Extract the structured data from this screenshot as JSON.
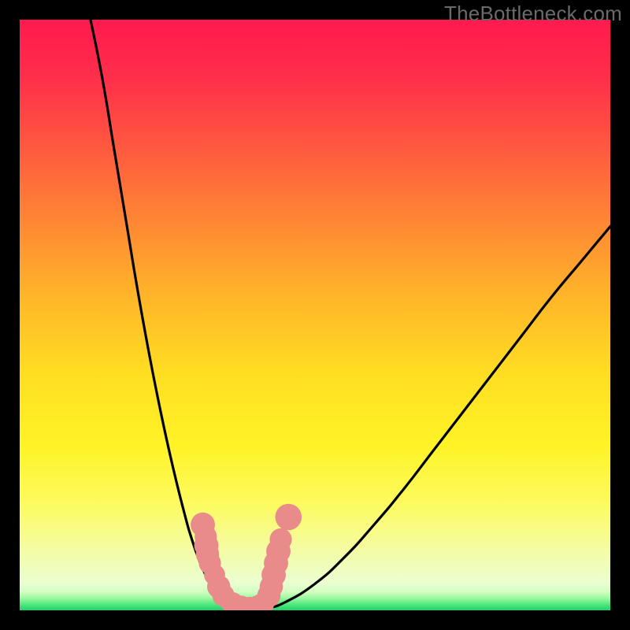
{
  "watermark": "TheBottleneck.com",
  "colors": {
    "background_black": "#000000",
    "curve_stroke": "#000000",
    "marker_fill": "#e98b8b",
    "marker_stroke": "#c56e6e"
  },
  "gradient_stops": [
    {
      "offset": 0.0,
      "color": "#ff1a4e"
    },
    {
      "offset": 0.1,
      "color": "#ff2f4a"
    },
    {
      "offset": 0.22,
      "color": "#ff5a3f"
    },
    {
      "offset": 0.35,
      "color": "#ff8a33"
    },
    {
      "offset": 0.48,
      "color": "#ffb928"
    },
    {
      "offset": 0.6,
      "color": "#ffde22"
    },
    {
      "offset": 0.72,
      "color": "#fff326"
    },
    {
      "offset": 0.82,
      "color": "#fdfb60"
    },
    {
      "offset": 0.9,
      "color": "#f4fca6"
    },
    {
      "offset": 0.955,
      "color": "#eafed2"
    },
    {
      "offset": 0.975,
      "color": "#c6ffb8"
    },
    {
      "offset": 0.988,
      "color": "#72f88f"
    },
    {
      "offset": 1.0,
      "color": "#22e06a"
    }
  ],
  "green_strip": {
    "top_frac": 0.968,
    "stops": [
      {
        "offset": 0.0,
        "color": "#d8ffc6"
      },
      {
        "offset": 0.35,
        "color": "#9cf9a0"
      },
      {
        "offset": 0.7,
        "color": "#4fe77e"
      },
      {
        "offset": 1.0,
        "color": "#1dd268"
      }
    ]
  },
  "chart_data": {
    "type": "line",
    "title": "",
    "xlabel": "",
    "ylabel": "",
    "xlim": [
      0,
      100
    ],
    "ylim": [
      0,
      100
    ],
    "annotations": [
      "TheBottleneck.com"
    ],
    "series": [
      {
        "name": "bottleneck-curve",
        "x": [
          12.0,
          14.0,
          16.0,
          18.0,
          20.0,
          22.0,
          24.0,
          26.0,
          28.0,
          29.0,
          30.0,
          31.0,
          32.0,
          33.0,
          34.0,
          35.0,
          36.0,
          38.0,
          40.0,
          42.0,
          45.0,
          50.0,
          55.0,
          60.0,
          65.0,
          70.0,
          75.0,
          80.0,
          85.0,
          90.0,
          95.0,
          100.0
        ],
        "y": [
          100.0,
          90.0,
          78.0,
          66.0,
          54.0,
          43.0,
          33.0,
          24.0,
          16.0,
          12.5,
          9.5,
          7.0,
          5.0,
          3.5,
          2.4,
          1.6,
          1.0,
          0.3,
          0.1,
          0.4,
          1.4,
          4.5,
          9.0,
          14.5,
          20.5,
          27.0,
          33.5,
          40.0,
          46.5,
          53.0,
          59.0,
          65.0
        ]
      }
    ],
    "markers": [
      {
        "x": 31.0,
        "y": 14.5,
        "r": 1.4
      },
      {
        "x": 31.5,
        "y": 12.5,
        "r": 1.2
      },
      {
        "x": 31.6,
        "y": 11.0,
        "r": 1.4
      },
      {
        "x": 31.8,
        "y": 9.5,
        "r": 1.3
      },
      {
        "x": 32.2,
        "y": 8.0,
        "r": 1.2
      },
      {
        "x": 33.0,
        "y": 6.0,
        "r": 1.1
      },
      {
        "x": 33.7,
        "y": 4.0,
        "r": 1.3
      },
      {
        "x": 34.5,
        "y": 2.5,
        "r": 1.2
      },
      {
        "x": 36.0,
        "y": 1.2,
        "r": 1.2
      },
      {
        "x": 37.5,
        "y": 0.6,
        "r": 1.2
      },
      {
        "x": 39.0,
        "y": 0.4,
        "r": 1.2
      },
      {
        "x": 40.2,
        "y": 0.6,
        "r": 1.2
      },
      {
        "x": 41.2,
        "y": 1.1,
        "r": 1.2
      },
      {
        "x": 42.2,
        "y": 2.5,
        "r": 1.3
      },
      {
        "x": 42.6,
        "y": 4.0,
        "r": 1.3
      },
      {
        "x": 43.0,
        "y": 6.0,
        "r": 1.4
      },
      {
        "x": 43.4,
        "y": 8.0,
        "r": 1.4
      },
      {
        "x": 43.8,
        "y": 10.0,
        "r": 1.4
      },
      {
        "x": 44.2,
        "y": 12.0,
        "r": 1.2
      },
      {
        "x": 45.5,
        "y": 15.8,
        "r": 1.6
      }
    ]
  }
}
